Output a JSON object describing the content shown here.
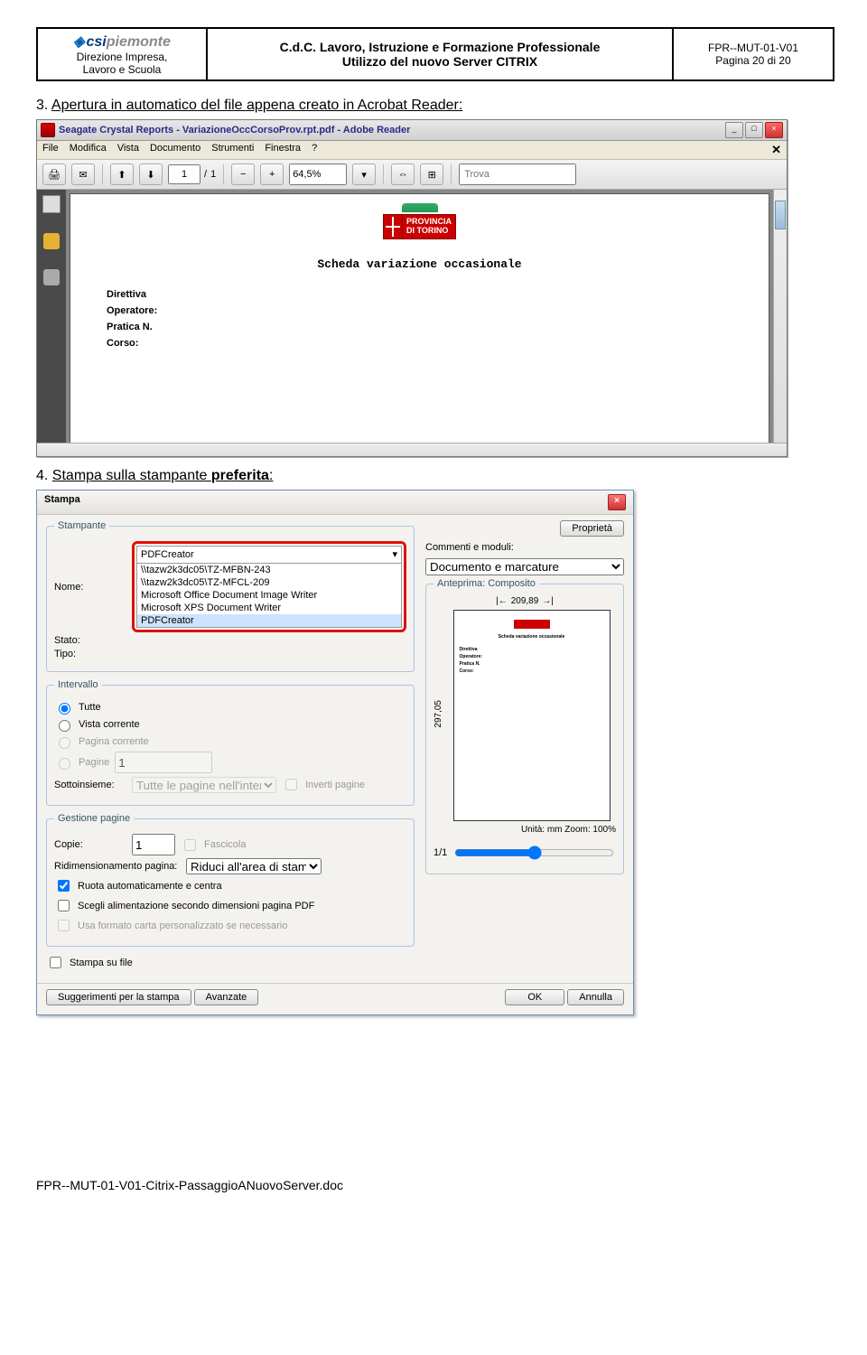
{
  "header": {
    "logo_main": "csi",
    "logo_suffix": "piemonte",
    "logo_subline1": "Direzione Impresa,",
    "logo_subline2": "Lavoro e Scuola",
    "center_line1": "C.d.C. Lavoro, Istruzione e Formazione Professionale",
    "center_line2": "Utilizzo del nuovo Server CITRIX",
    "right_line1": "FPR--MUT-01-V01",
    "right_line2": "Pagina 20 di 20"
  },
  "step3": {
    "num": "3.",
    "text": "Apertura in automatico del file appena creato in Acrobat Reader:"
  },
  "adobe": {
    "title": "Seagate Crystal Reports - VariazioneOccCorsoProv.rpt.pdf - Adobe Reader",
    "menus": [
      "File",
      "Modifica",
      "Vista",
      "Documento",
      "Strumenti",
      "Finestra",
      "?"
    ],
    "page_cur": "1",
    "page_sep": "/",
    "page_tot": "1",
    "zoom": "64,5%",
    "find_placeholder": "Trova",
    "doc_title": "Scheda variazione occasionale",
    "prov_line1": "PROVINCIA",
    "prov_line2": "DI TORINO",
    "fields": [
      "Direttiva",
      "Operatore:",
      "Pratica N.",
      "Corso:"
    ]
  },
  "step4": {
    "num": "4.",
    "text_a": "Stampa sulla stampante ",
    "text_b": "preferita",
    "text_c": ":"
  },
  "print": {
    "title": "Stampa",
    "grp_stampante": "Stampante",
    "lbl_nome": "Nome:",
    "lbl_stato": "Stato:",
    "lbl_tipo": "Tipo:",
    "selected_printer": "PDFCreator",
    "printers": [
      "\\\\tazw2k3dc05\\TZ-MFBN-243",
      "\\\\tazw2k3dc05\\TZ-MFCL-209",
      "Microsoft Office Document Image Writer",
      "Microsoft XPS Document Writer",
      "PDFCreator"
    ],
    "btn_proprieta": "Proprietà",
    "lbl_commenti": "Commenti e moduli:",
    "val_commenti": "Documento e marcature",
    "grp_intervallo": "Intervallo",
    "r_tutte": "Tutte",
    "r_vista": "Vista corrente",
    "r_pagcorr": "Pagina corrente",
    "r_pagine": "Pagine",
    "pagine_val": "1",
    "lbl_sotto": "Sottoinsieme:",
    "val_sotto": "Tutte le pagine nell'intervallo",
    "chk_inverti": "Inverti pagine",
    "grp_gestione": "Gestione pagine",
    "lbl_copie": "Copie:",
    "val_copie": "1",
    "chk_fascicola": "Fascicola",
    "lbl_ridim": "Ridimensionamento pagina:",
    "val_ridim": "Riduci all'area di stampa",
    "chk_ruota": "Ruota automaticamente e centra",
    "chk_alim": "Scegli alimentazione secondo dimensioni pagina PDF",
    "chk_formato": "Usa formato carta personalizzato se necessario",
    "chk_file": "Stampa su file",
    "grp_anteprima": "Anteprima: Composito",
    "prev_w": "209,89",
    "prev_h": "297,05",
    "prev_title": "Scheda variazione occasionale",
    "prev_units": "Unità: mm Zoom: 100%",
    "prev_pagenum": "1/1",
    "btn_sugg": "Suggerimenti per la stampa",
    "btn_avanz": "Avanzate",
    "btn_ok": "OK",
    "btn_annulla": "Annulla"
  },
  "footer": "FPR--MUT-01-V01-Citrix-PassaggioANuovoServer.doc"
}
